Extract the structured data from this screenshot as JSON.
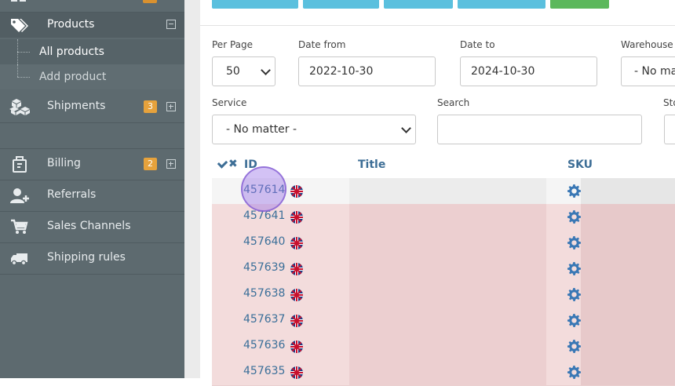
{
  "sidebar": {
    "products": {
      "label": "Products"
    },
    "sub_items": [
      {
        "label": "All products"
      },
      {
        "label": "Add product"
      }
    ],
    "items": [
      {
        "label": "Shipments",
        "badge": "3"
      },
      {
        "label": "Billing",
        "badge": "2"
      },
      {
        "label": "Referrals"
      },
      {
        "label": "Sales Channels"
      },
      {
        "label": "Shipping rules"
      }
    ]
  },
  "filters": {
    "per_page": {
      "label": "Per Page",
      "value": "50"
    },
    "date_from": {
      "label": "Date from",
      "value": "2022-10-30"
    },
    "date_to": {
      "label": "Date to",
      "value": "2024-10-30"
    },
    "warehouse": {
      "label": "Warehouse",
      "value": "- No ma"
    },
    "service": {
      "label": "Service",
      "value": "- No matter -"
    },
    "search": {
      "label": "Search",
      "value": ""
    },
    "stock": {
      "label": "Sto"
    }
  },
  "table": {
    "columns": {
      "id": "ID",
      "title": "Title",
      "sku": "SKU"
    },
    "rows": [
      {
        "id": "457614"
      },
      {
        "id": "457641"
      },
      {
        "id": "457640"
      },
      {
        "id": "457639"
      },
      {
        "id": "457638"
      },
      {
        "id": "457637"
      },
      {
        "id": "457636"
      },
      {
        "id": "457635"
      }
    ]
  },
  "colors": {
    "sidebar_bg": "#5d6a6f",
    "link_blue": "#3a6f99",
    "row_highlight": "#f3dcdc",
    "badge_orange": "#e6a23c",
    "top_button_blue": "#5bc0de",
    "top_button_green": "#5cb85c"
  }
}
